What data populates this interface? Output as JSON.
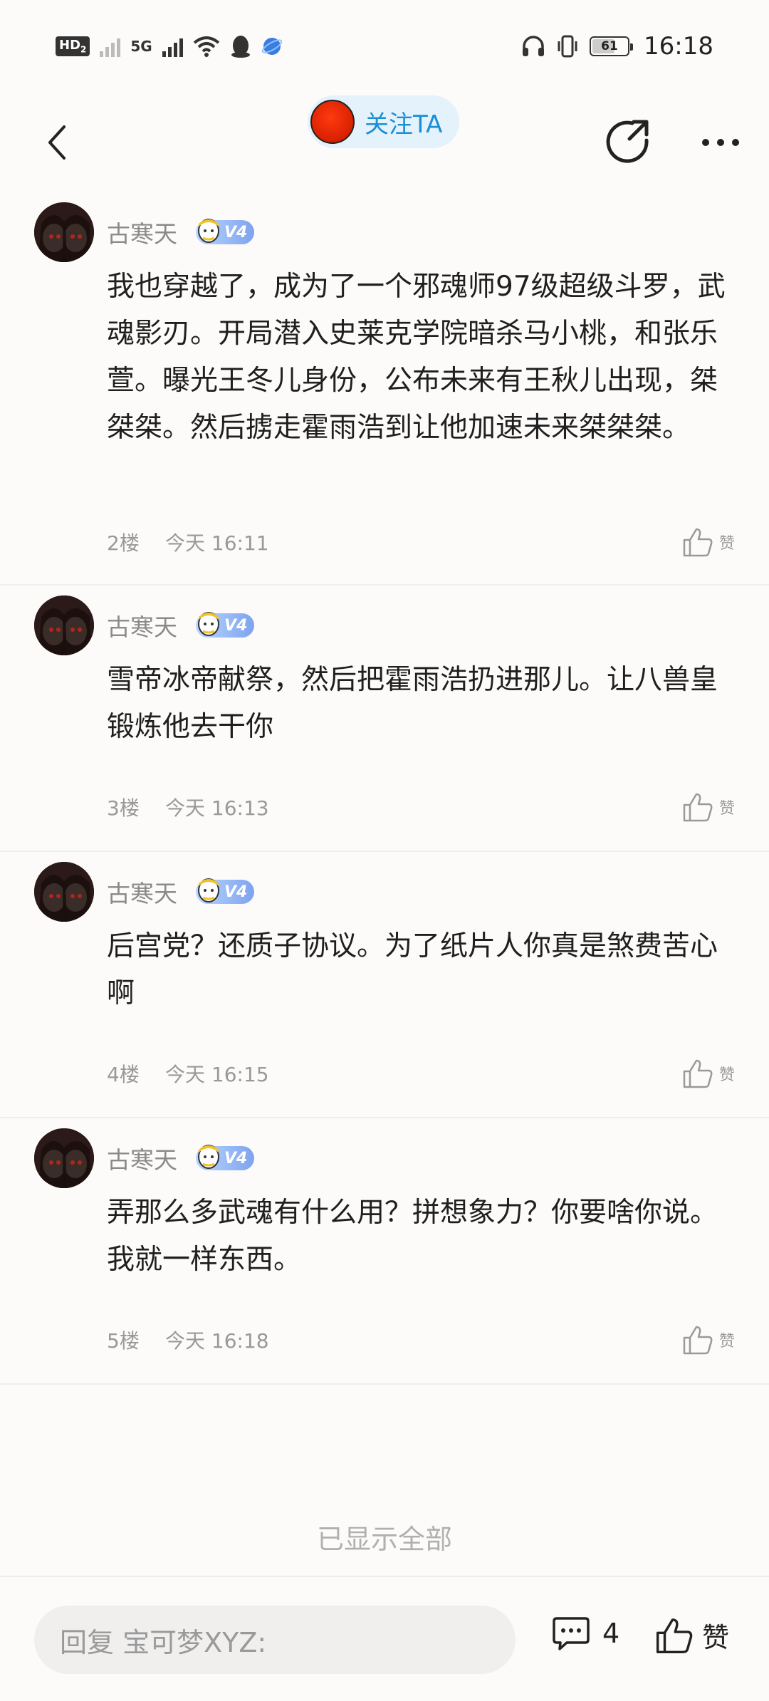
{
  "status_bar": {
    "left_chip": "HD",
    "left_chip_sub": "2",
    "network": "5G",
    "battery": "61",
    "time": "16:18"
  },
  "header": {
    "follow_label": "关注TA",
    "icons": [
      "back-arrow-icon",
      "refresh-share-icon",
      "more-dots-icon"
    ]
  },
  "comments": [
    {
      "username": "古寒天",
      "level": "V4",
      "text": "我也穿越了，成为了一个邪魂师97级超级斗罗，武魂影刃。开局潜入史莱克学院暗杀马小桃，和张乐萱。曝光王冬儿身份，公布未来有王秋儿出现，桀桀桀。然后掳走霍雨浩到让他加速未来桀桀桀。",
      "floor": "2楼",
      "time": "今天 16:11",
      "like_label": "赞"
    },
    {
      "username": "古寒天",
      "level": "V4",
      "text": "雪帝冰帝献祭，然后把霍雨浩扔进那儿。让八兽皇锻炼他去干你",
      "floor": "3楼",
      "time": "今天 16:13",
      "like_label": "赞"
    },
    {
      "username": "古寒天",
      "level": "V4",
      "text": "后宫党？还质子协议。为了纸片人你真是煞费苦心啊",
      "floor": "4楼",
      "time": "今天 16:15",
      "like_label": "赞"
    },
    {
      "username": "古寒天",
      "level": "V4",
      "text": "弄那么多武魂有什么用？拼想象力？你要啥你说。我就一样东西。",
      "floor": "5楼",
      "time": "今天 16:18",
      "like_label": "赞"
    }
  ],
  "footer_note": "已显示全部",
  "bottom_bar": {
    "reply_placeholder": "回复 宝可梦XYZ:",
    "comment_count": "4",
    "like_label": "赞"
  },
  "colors": {
    "accent": "#1b8fd6",
    "follow_bg": "#e3f2fb",
    "meta_gray": "#999999"
  }
}
